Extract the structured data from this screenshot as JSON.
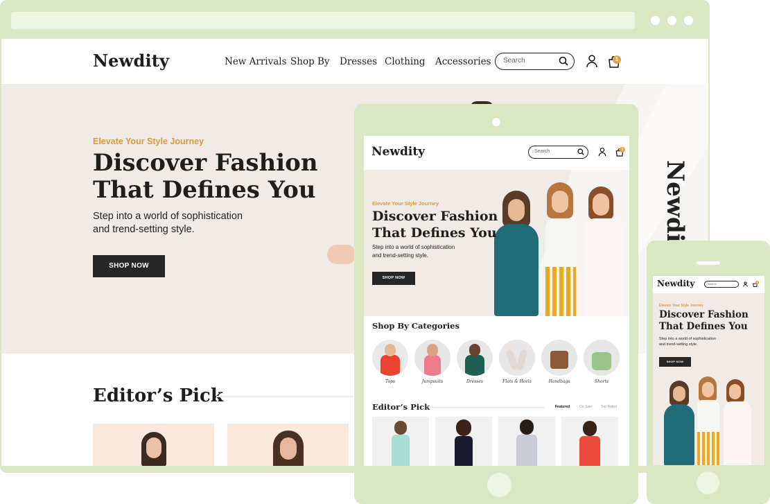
{
  "brand": "Newdity",
  "nav": {
    "items": [
      "New Arrivals",
      "Shop By",
      "Dresses",
      "Clothing",
      "Accessories"
    ]
  },
  "search": {
    "placeholder": "Search"
  },
  "cart": {
    "count": "1"
  },
  "hero": {
    "eyebrow": "Elevate Your Style Journey",
    "title_line1": "Discover Fashion",
    "title_line2": "That Defines You",
    "subtitle_line1": "Step into a world of sophistication",
    "subtitle_line2": "and trend-setting style.",
    "cta": "SHOP NOW"
  },
  "side_logo": "Newdity",
  "editors_pick": {
    "title": "Editor’s Pick",
    "tabs": [
      "Featured",
      "On Sale",
      "Top Rated"
    ]
  },
  "categories": {
    "title": "Shop By Categories",
    "items": [
      "Tops",
      "Jumpsuits",
      "Dresses",
      "Flats & Heels",
      "Handbags",
      "Shorts"
    ]
  },
  "colors": {
    "frame": "#d9e7c2",
    "accent": "#d99a3a",
    "hero_bg": "#f0ebe6",
    "button": "#262626"
  }
}
